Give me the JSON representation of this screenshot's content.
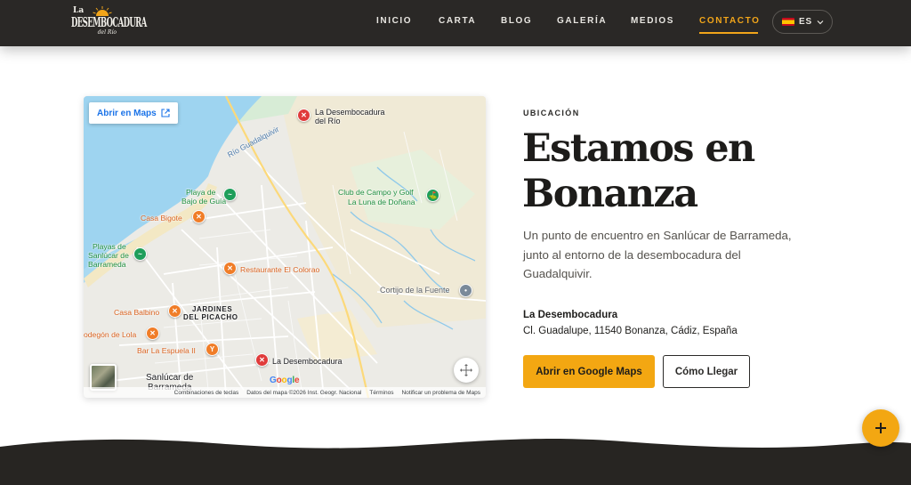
{
  "logo": {
    "line1": "La",
    "line2": "DESEMBOCADURA",
    "line3": "del Río"
  },
  "nav": {
    "items": [
      {
        "label": "INICIO"
      },
      {
        "label": "CARTA"
      },
      {
        "label": "BLOG"
      },
      {
        "label": "GALERÍA"
      },
      {
        "label": "MEDIOS"
      },
      {
        "label": "CONTACTO",
        "active": true
      }
    ],
    "language": "ES"
  },
  "map": {
    "open_maps_label": "Abrir en Maps",
    "labels": {
      "desembocadura_rio": "La Desembocadura",
      "desembocadura_rio_2": "del Río",
      "rio_guadalquivir": "Río Guadalquivir",
      "playa_bajo_guia_1": "Playa de",
      "playa_bajo_guia_2": "Bajo de Guía",
      "casa_bigote": "Casa Bigote",
      "club_campo_1": "Club de Campo y Golf",
      "club_campo_2": "La Luna de Doñana",
      "playas_sanlucar_1": "Playas de",
      "playas_sanlucar_2": "Sanlúcar de",
      "playas_sanlucar_3": "Barrameda",
      "restaurante_colorao": "Restaurante El Colorao",
      "cortijo_fuente": "Cortijo de la Fuente",
      "jardines_1": "JARDINES",
      "jardines_2": "DEL PICACHO",
      "casa_balbino": "Casa Balbino",
      "bodegon_lola": "odegón de Lola",
      "bar_espuela": "Bar La Espuela II",
      "la_desembocadura": "La Desembocadura",
      "sanlucar_1": "Sanlúcar de",
      "sanlucar_2": "Barrameda"
    },
    "attribution": {
      "shortcuts": "Combinaciones de teclas",
      "data": "Datos del mapa ©2026 Inst. Geogr. Nacional",
      "terms": "Términos",
      "report": "Notificar un problema de Maps"
    },
    "google": "Google"
  },
  "location": {
    "eyebrow": "UBICACIÓN",
    "title": "Estamos en Bonanza",
    "description": "Un punto de encuentro en Sanlúcar de Barrameda, junto al entorno de la desembocadura del Guadalquivir.",
    "place_name": "La Desembocadura",
    "address": "Cl. Guadalupe, 11540 Bonanza, Cádiz, España",
    "primary_button": "Abrir en Google Maps",
    "secondary_button": "Cómo Llegar"
  },
  "colors": {
    "accent": "#f3a712",
    "header_bg": "#2a2826",
    "water": "#9ed4f0"
  },
  "icons": {
    "fab": "plus-icon",
    "external": "external-link-icon",
    "fullscreen": "fullscreen-icon",
    "dropdown": "chevron-down-icon"
  }
}
